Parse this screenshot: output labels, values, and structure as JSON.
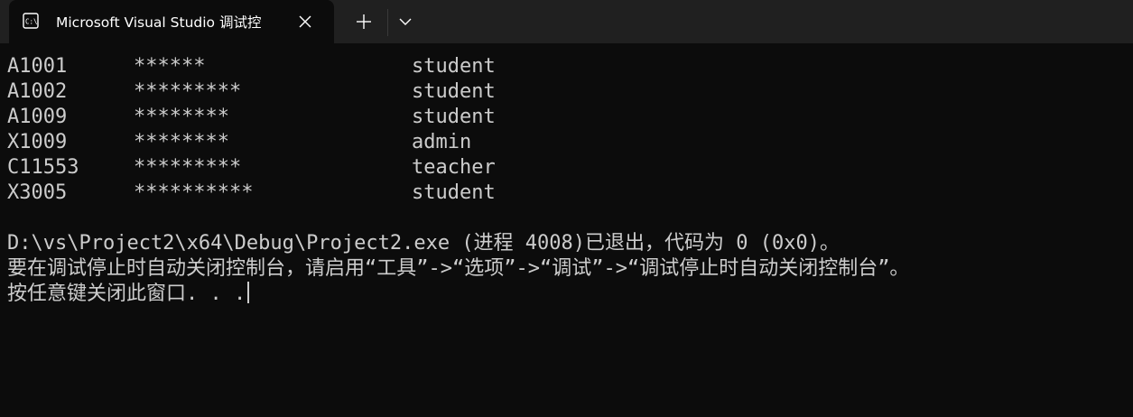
{
  "window": {
    "tab": {
      "icon": "console-icon",
      "title": "Microsoft Visual Studio 调试控",
      "close_icon": "close-icon"
    },
    "new_tab_icon": "plus-icon",
    "dropdown_icon": "chevron-down-icon"
  },
  "terminal": {
    "rows": [
      {
        "id": "A1001",
        "password": "******",
        "role": "student"
      },
      {
        "id": "A1002",
        "password": "*********",
        "role": "student"
      },
      {
        "id": "A1009",
        "password": "********",
        "role": "student"
      },
      {
        "id": "X1009",
        "password": "********",
        "role": "admin"
      },
      {
        "id": "C11553",
        "password": "*********",
        "role": "teacher"
      },
      {
        "id": "X3005",
        "password": "**********",
        "role": "student"
      }
    ],
    "exit_line": "D:\\vs\\Project2\\x64\\Debug\\Project2.exe (进程 4008)已退出，代码为 0 (0x0)。",
    "hint_line": "要在调试停止时自动关闭控制台，请启用“工具”->“选项”->“调试”->“调试停止时自动关闭控制台”。",
    "prompt_line": "按任意键关闭此窗口. . ."
  },
  "colors": {
    "background": "#0c0c0c",
    "titlebar": "#202020",
    "text": "#cccccc"
  }
}
